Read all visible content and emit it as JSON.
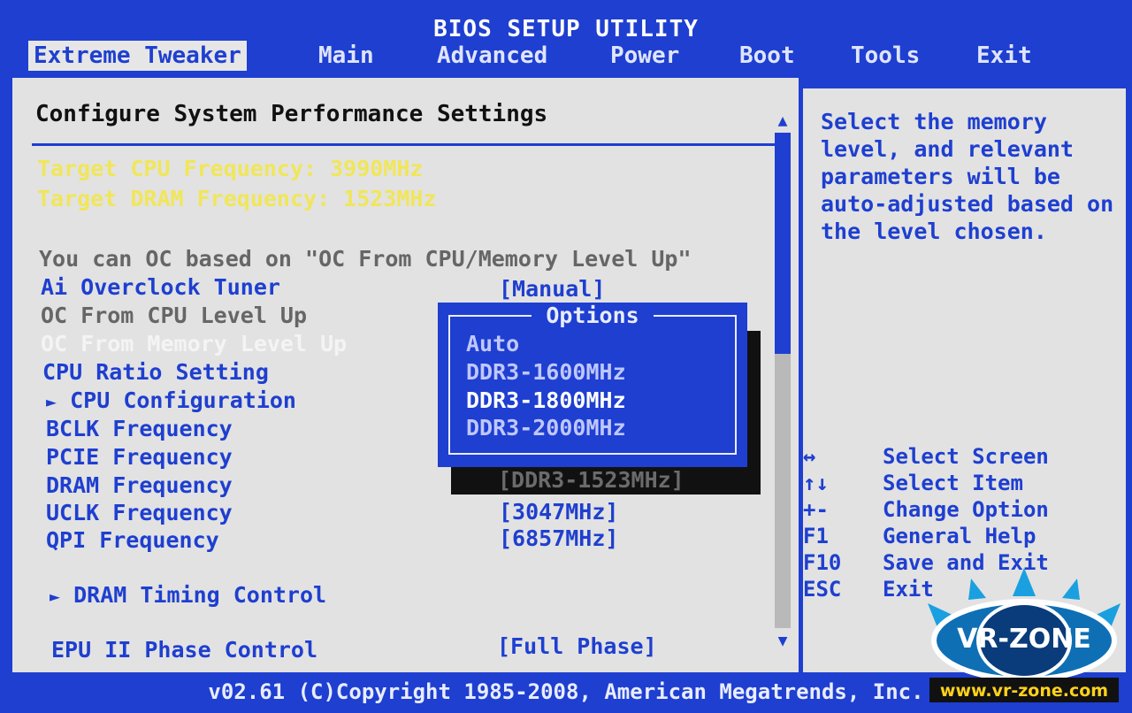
{
  "window": {
    "title": "BIOS SETUP UTILITY"
  },
  "menu": [
    {
      "label": "Extreme Tweaker",
      "active": true
    },
    {
      "label": "Main"
    },
    {
      "label": "Advanced"
    },
    {
      "label": "Power"
    },
    {
      "label": "Boot"
    },
    {
      "label": "Tools"
    },
    {
      "label": "Exit"
    }
  ],
  "left": {
    "header": "Configure System Performance Settings",
    "target_cpu": "Target CPU Frequency: 3990MHz",
    "target_dram": "Target DRAM Frequency: 1523MHz",
    "oc_note": "You can OC based on \"OC From CPU/Memory Level Up\"",
    "items": {
      "ai_tuner": "Ai Overclock Tuner",
      "oc_cpu": "OC From CPU Level Up",
      "oc_mem": "OC From Memory Level Up",
      "cpu_ratio": "CPU Ratio Setting",
      "cpu_config": "CPU Configuration",
      "bclk": "BCLK Frequency",
      "pcie": "PCIE Frequency",
      "dram": "DRAM Frequency",
      "uclk": "UCLK Frequency",
      "qpi": "QPI Frequency",
      "dram_timing": "DRAM Timing Control",
      "epu": "EPU II Phase Control"
    },
    "values": {
      "ai_tuner": "[Manual]",
      "dram": "[DDR3-1523MHz]",
      "uclk": "[3047MHz]",
      "qpi": "[6857MHz]",
      "epu": "[Full Phase]"
    },
    "submenu_arrow": "►",
    "scroll_up": "▲",
    "scroll_down": "▼"
  },
  "popup": {
    "title": "Options",
    "options": [
      "Auto",
      "DDR3-1600MHz",
      "DDR3-1800MHz",
      "DDR3-2000MHz"
    ],
    "selected": "DDR3-1800MHz"
  },
  "help": {
    "text": "Select the memory level, and relevant parameters will be auto-adjusted based on the level chosen.",
    "keys": [
      {
        "key": "↔",
        "desc": "Select Screen"
      },
      {
        "key": "↑↓",
        "desc": "Select Item"
      },
      {
        "key": "+-",
        "desc": "Change Option"
      },
      {
        "key": "F1",
        "desc": "General Help"
      },
      {
        "key": "F10",
        "desc": "Save and Exit"
      },
      {
        "key": "ESC",
        "desc": "Exit"
      }
    ]
  },
  "footer": "v02.61 (C)Copyright 1985-2008, American Megatrends, Inc.",
  "logo": {
    "text": "VR-ZONE",
    "url": "www.vr-zone.com"
  },
  "colors": {
    "bios_blue": "#1e3fd0",
    "panel_gray": "#e2e2e2",
    "yellow": "#f0e65a"
  }
}
